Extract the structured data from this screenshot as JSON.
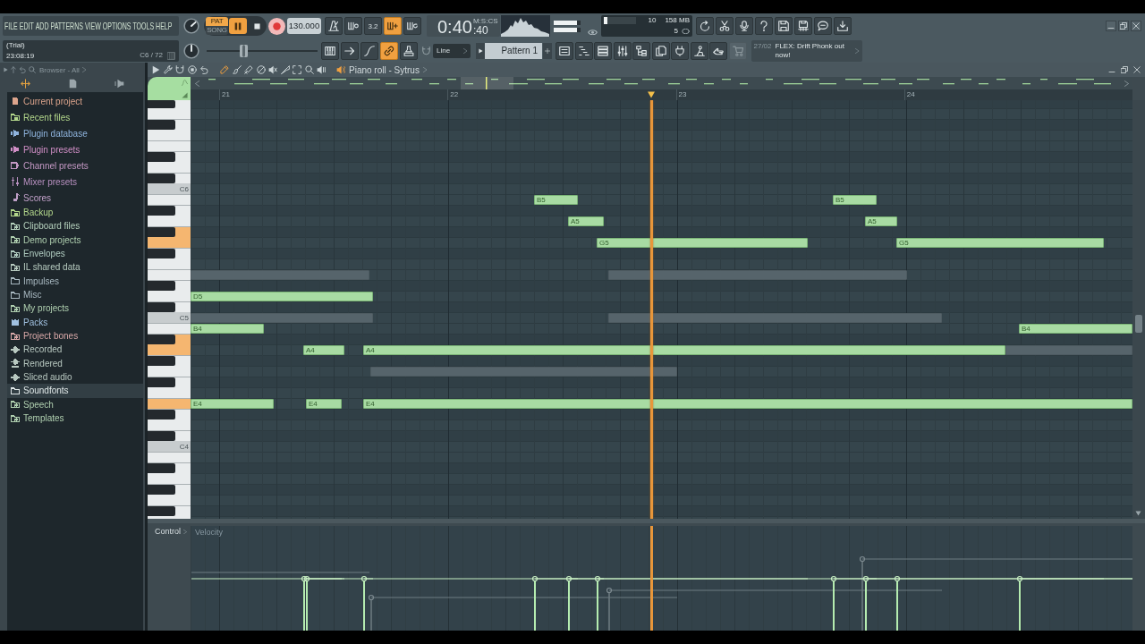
{
  "toolbar": {
    "menu": [
      "FILE",
      "EDIT",
      "ADD",
      "PATTERNS",
      "VIEW",
      "OPTIONS",
      "TOOLS",
      "HELP"
    ],
    "modes": [
      {
        "label": "PAT",
        "selected": true
      },
      {
        "label": "SONG",
        "selected": false
      }
    ],
    "playing": true,
    "tempo": "130.000",
    "record_toggles": [
      {
        "on": false
      },
      {
        "on": false
      },
      {
        "on": false,
        "label": "3.2"
      },
      {
        "on": true
      },
      {
        "on": false
      }
    ],
    "clock": {
      "units": "M:S:CS",
      "time": "0:40",
      "centiseconds": ":40"
    },
    "peak_meters": [
      {
        "level": 0.85
      },
      {
        "level": 0.85
      }
    ],
    "monitor": {
      "level": 0.12,
      "top_value": "10",
      "memory": "158 MB",
      "bottom_value": "5"
    },
    "info": {
      "title": "(Trial)",
      "time": "23:08:19",
      "note": "C6 / 72"
    },
    "pitch_slider": {
      "level": 0.32
    },
    "tool_toggles": [
      {
        "on": false
      },
      {
        "on": false
      },
      {
        "on": false
      },
      {
        "on": true
      },
      {
        "on": false
      }
    ],
    "snap": "Line",
    "pattern": "Pattern 1",
    "news": {
      "date": "27/02",
      "headline": "FLEX: Drift Phonk out now!"
    }
  },
  "browser": {
    "title": "Browser - All",
    "tabs": [
      {
        "selected": true
      },
      {
        "selected": false
      },
      {
        "selected": false
      }
    ],
    "items": [
      {
        "label": "Current project",
        "kind": "project",
        "color": "#dca48c",
        "selected": false
      },
      {
        "label": "Recent files",
        "kind": "history",
        "color": "#b4d88c",
        "selected": false
      },
      {
        "label": "Plugin database",
        "kind": "plugin",
        "color": "#8fb4de",
        "selected": false
      },
      {
        "label": "Plugin presets",
        "kind": "plugin",
        "color": "#d08ec6",
        "selected": false
      },
      {
        "label": "Channel presets",
        "kind": "channel",
        "color": "#c498c4",
        "selected": false
      },
      {
        "label": "Mixer presets",
        "kind": "mixer",
        "color": "#b890c0",
        "selected": false
      },
      {
        "label": "Scores",
        "kind": "score",
        "color": "#c0a0c8",
        "selected": false
      },
      {
        "label": "Backup",
        "kind": "history",
        "color": "#b4d88c",
        "selected": false
      },
      {
        "label": "Clipboard files",
        "kind": "linked-folder",
        "color": "#b4d0bc",
        "selected": false
      },
      {
        "label": "Demo projects",
        "kind": "linked-folder",
        "color": "#b0d0b0",
        "selected": false
      },
      {
        "label": "Envelopes",
        "kind": "linked-folder",
        "color": "#b0ccc0",
        "selected": false
      },
      {
        "label": "IL shared data",
        "kind": "linked-folder",
        "color": "#b8ccc0",
        "selected": false
      },
      {
        "label": "Impulses",
        "kind": "folder",
        "color": "#a8b8c0",
        "selected": false
      },
      {
        "label": "Misc",
        "kind": "folder",
        "color": "#a8b8c0",
        "selected": false
      },
      {
        "label": "My projects",
        "kind": "linked-folder",
        "color": "#b0d0b0",
        "selected": false
      },
      {
        "label": "Packs",
        "kind": "packs",
        "color": "#a0c0e0",
        "selected": false
      },
      {
        "label": "Project bones",
        "kind": "linked-folder",
        "color": "#d8a8a8",
        "selected": false
      },
      {
        "label": "Recorded",
        "kind": "recorded",
        "color": "#b8c8c0",
        "selected": false
      },
      {
        "label": "Rendered",
        "kind": "rendered",
        "color": "#b8c8c0",
        "selected": false
      },
      {
        "label": "Sliced audio",
        "kind": "recorded",
        "color": "#b8c8c0",
        "selected": false
      },
      {
        "label": "Soundfonts",
        "kind": "folder",
        "color": "#e0e8e8",
        "selected": true
      },
      {
        "label": "Speech",
        "kind": "linked-folder",
        "color": "#b0d0b0",
        "selected": false
      },
      {
        "label": "Templates",
        "kind": "linked-folder",
        "color": "#b0d0b0",
        "selected": false
      }
    ]
  },
  "piano_roll": {
    "title": "Piano roll - Sytrus",
    "tools": [
      {
        "selected": true
      },
      {
        "selected": false
      },
      {
        "selected": false
      },
      {
        "selected": false
      },
      {
        "selected": false
      },
      {
        "selected": false
      },
      {
        "selected": false
      },
      {
        "selected": false
      },
      {
        "selected": false
      }
    ],
    "bars": [
      "21",
      "22",
      "23",
      "24"
    ],
    "keys": [
      {
        "active": false
      },
      {
        "active": false
      },
      {
        "active": false
      },
      {
        "active": false
      },
      {
        "label": "C6",
        "active": false
      },
      {
        "active": false
      },
      {
        "active": false
      },
      {
        "active": true
      },
      {
        "active": false
      },
      {
        "active": false
      },
      {
        "active": false
      },
      {
        "label": "C5",
        "active": false
      },
      {
        "active": false
      },
      {
        "active": true
      },
      {
        "active": false
      },
      {
        "active": false
      },
      {
        "active": true
      },
      {
        "active": false
      },
      {
        "label": "C4",
        "active": false
      },
      {
        "active": false
      },
      {
        "active": false
      },
      {
        "active": false
      },
      {
        "active": false
      }
    ],
    "notes": [
      {
        "label": "B5",
        "kind": "note"
      },
      {
        "label": "B5",
        "kind": "note"
      },
      {
        "label": "A5",
        "kind": "note"
      },
      {
        "label": "A5",
        "kind": "note"
      },
      {
        "label": "G5",
        "kind": "note"
      },
      {
        "label": "G5",
        "kind": "note"
      },
      {
        "kind": "ghost"
      },
      {
        "kind": "ghost"
      },
      {
        "label": "D5",
        "kind": "note"
      },
      {
        "kind": "ghost"
      },
      {
        "kind": "ghost"
      },
      {
        "label": "B4",
        "kind": "note"
      },
      {
        "label": "B4",
        "kind": "note"
      },
      {
        "label": "A4",
        "kind": "note"
      },
      {
        "label": "A4",
        "kind": "note"
      },
      {
        "kind": "ghost"
      },
      {
        "kind": "ghost"
      },
      {
        "label": "E4",
        "kind": "note"
      },
      {
        "label": "E4",
        "kind": "note"
      },
      {
        "label": "E4",
        "kind": "note"
      }
    ]
  },
  "control": {
    "label": "Control",
    "parameter": "Velocity"
  }
}
